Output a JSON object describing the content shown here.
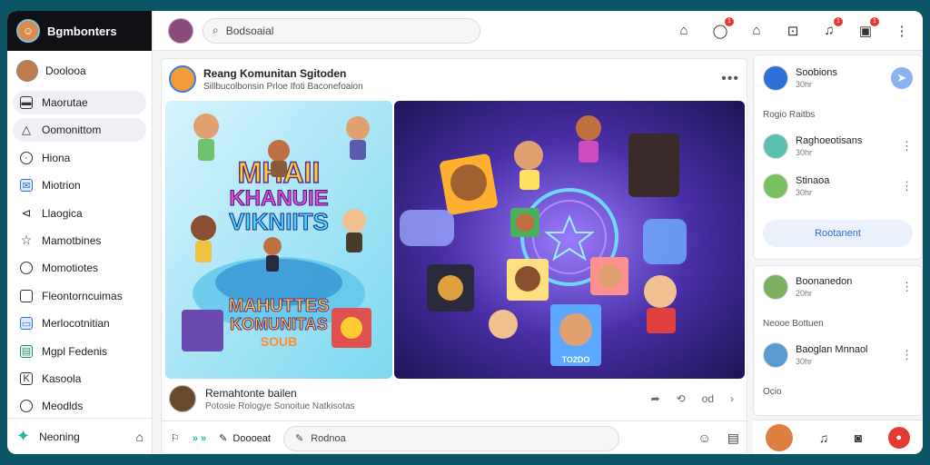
{
  "sidebar": {
    "brand": "Bgmbonters",
    "profile": "Doolooa",
    "items": [
      {
        "label": "Maorutae",
        "icon": "inbox-icon"
      },
      {
        "label": "Oomonittom",
        "icon": "triangle-icon"
      },
      {
        "label": "Hiona",
        "icon": "search-icon"
      },
      {
        "label": "Miotrion",
        "icon": "mail-icon"
      },
      {
        "label": "Llaogica",
        "icon": "compass-icon"
      },
      {
        "label": "Mamotbines",
        "icon": "star-icon"
      },
      {
        "label": "Momotiotes",
        "icon": "chat-icon"
      },
      {
        "label": "Fleontorncuimas",
        "icon": "document-icon"
      },
      {
        "label": "Merlocotnitian",
        "icon": "calendar-icon"
      },
      {
        "label": "Mgpl Fedenis",
        "icon": "chart-icon"
      },
      {
        "label": "Kasoola",
        "icon": "k-icon"
      },
      {
        "label": "Meodlds",
        "icon": "circle-icon"
      }
    ],
    "footer": "Neoning"
  },
  "topbar": {
    "search_value": "Bodsoaial",
    "badges": [
      "1",
      "1",
      "1"
    ]
  },
  "post": {
    "title": "Reang Komunitan Sgitoden",
    "subtitle": "Sillbucolbonsin Prloe Ifoti Baconefoaion",
    "poster_title_1": "MHAII",
    "poster_title_2": "KHANUIE",
    "poster_title_3": "VIKNIITS",
    "poster_sub_1": "MAHUTTES",
    "poster_sub_2": "KOMUNITAS",
    "poster_sub_3": "SOUB",
    "card_label": "TO2DO"
  },
  "post_footer": {
    "name": "Remahtonte bailen",
    "meta": "Potosie Rologye Sonoitue Natkisotas",
    "action": "od"
  },
  "composer": {
    "left_label": "Doooeat",
    "input_value": "Rodnoa"
  },
  "right": {
    "top_card": {
      "name": "Soobions",
      "sub": "30hr"
    },
    "section1": "Rogio Raitbs",
    "users1": [
      {
        "name": "Raghoeotisans",
        "sub": "30hr"
      },
      {
        "name": "Stinaoa",
        "sub": "30hr"
      }
    ],
    "button": "Rootanent",
    "user_mid": {
      "name": "Boonanedon",
      "sub": "20hr"
    },
    "section2": "Neooe Bottuen",
    "user_bottom": {
      "name": "Baoglan Mnnaol",
      "sub": "30hr"
    },
    "section3": "Ocio"
  },
  "colors": {
    "accent": "#2f6fd8",
    "teal": "#1bb9a3",
    "frame_bg": "#0d5566",
    "badge": "#e53935"
  }
}
